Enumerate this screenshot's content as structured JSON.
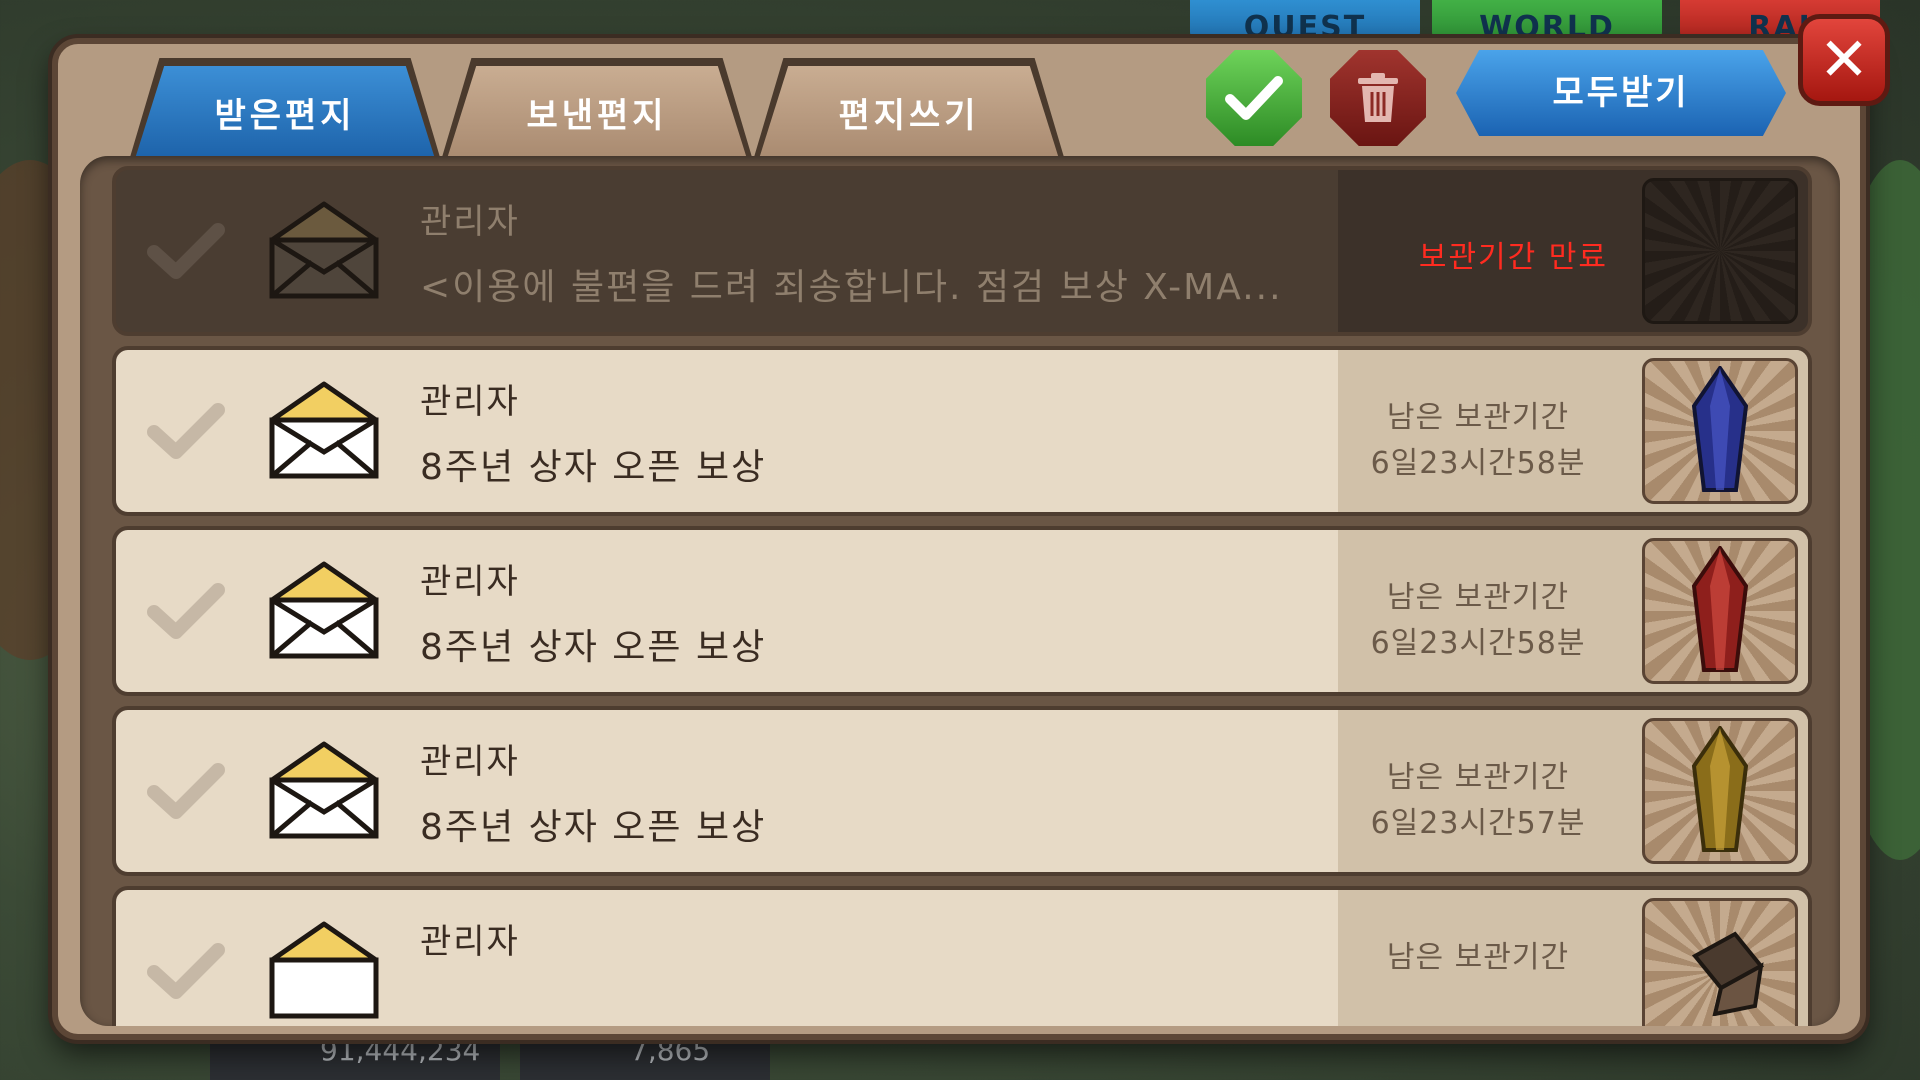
{
  "background": {
    "top_tabs": [
      "QUEST",
      "WORLD",
      "RAI"
    ],
    "gold": "91,444,234",
    "gems": "7,865"
  },
  "tabs": [
    {
      "label": "받은편지",
      "active": true
    },
    {
      "label": "보낸편지",
      "active": false
    },
    {
      "label": "편지쓰기",
      "active": false
    }
  ],
  "actions": {
    "claim_all_label": "모두받기",
    "select_icon": "check-icon",
    "delete_icon": "trash-icon",
    "close_icon": "close-icon"
  },
  "mails": [
    {
      "sender": "관리자",
      "subject": "<이용에 불편을 드려 죄송합니다. 점검 보상 X-MA...",
      "expired": true,
      "status": "보관기간 만료",
      "reward": "none"
    },
    {
      "sender": "관리자",
      "subject": "8주년 상자 오픈 보상",
      "expired": false,
      "remain_label": "남은 보관기간",
      "remain_time": "6일23시간58분",
      "reward": "blue-crystal"
    },
    {
      "sender": "관리자",
      "subject": "8주년 상자 오픈 보상",
      "expired": false,
      "remain_label": "남은 보관기간",
      "remain_time": "6일23시간58분",
      "reward": "red-crystal"
    },
    {
      "sender": "관리자",
      "subject": "8주년 상자 오픈 보상",
      "expired": false,
      "remain_label": "남은 보관기간",
      "remain_time": "6일23시간57분",
      "reward": "gold-crystal"
    },
    {
      "sender": "관리자",
      "subject": "",
      "expired": false,
      "remain_label": "남은 보관기간",
      "remain_time": "",
      "reward": "dark-item"
    }
  ],
  "colors": {
    "tab_active": "#1c61a8",
    "expired_text": "#ff2b20",
    "panel": "#b49b82"
  }
}
